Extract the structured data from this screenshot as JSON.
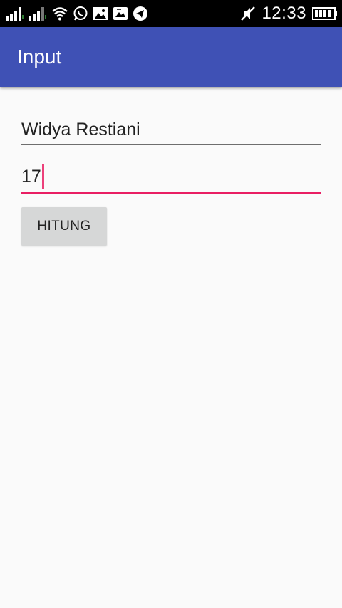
{
  "status_bar": {
    "time": "12:33",
    "icons": [
      "signal-icon",
      "signal-icon",
      "wifi-icon",
      "whatsapp-icon",
      "image-icon",
      "gallery-icon",
      "telegram-icon",
      "mute-icon",
      "battery-icon"
    ]
  },
  "app_bar": {
    "title": "Input"
  },
  "form": {
    "name_value": "Widya Restiani",
    "age_value": "17",
    "button_label": "HITUNG"
  },
  "colors": {
    "primary": "#3f51b5",
    "accent": "#e91e63",
    "background": "#fafafa",
    "button": "#d6d7d7"
  }
}
